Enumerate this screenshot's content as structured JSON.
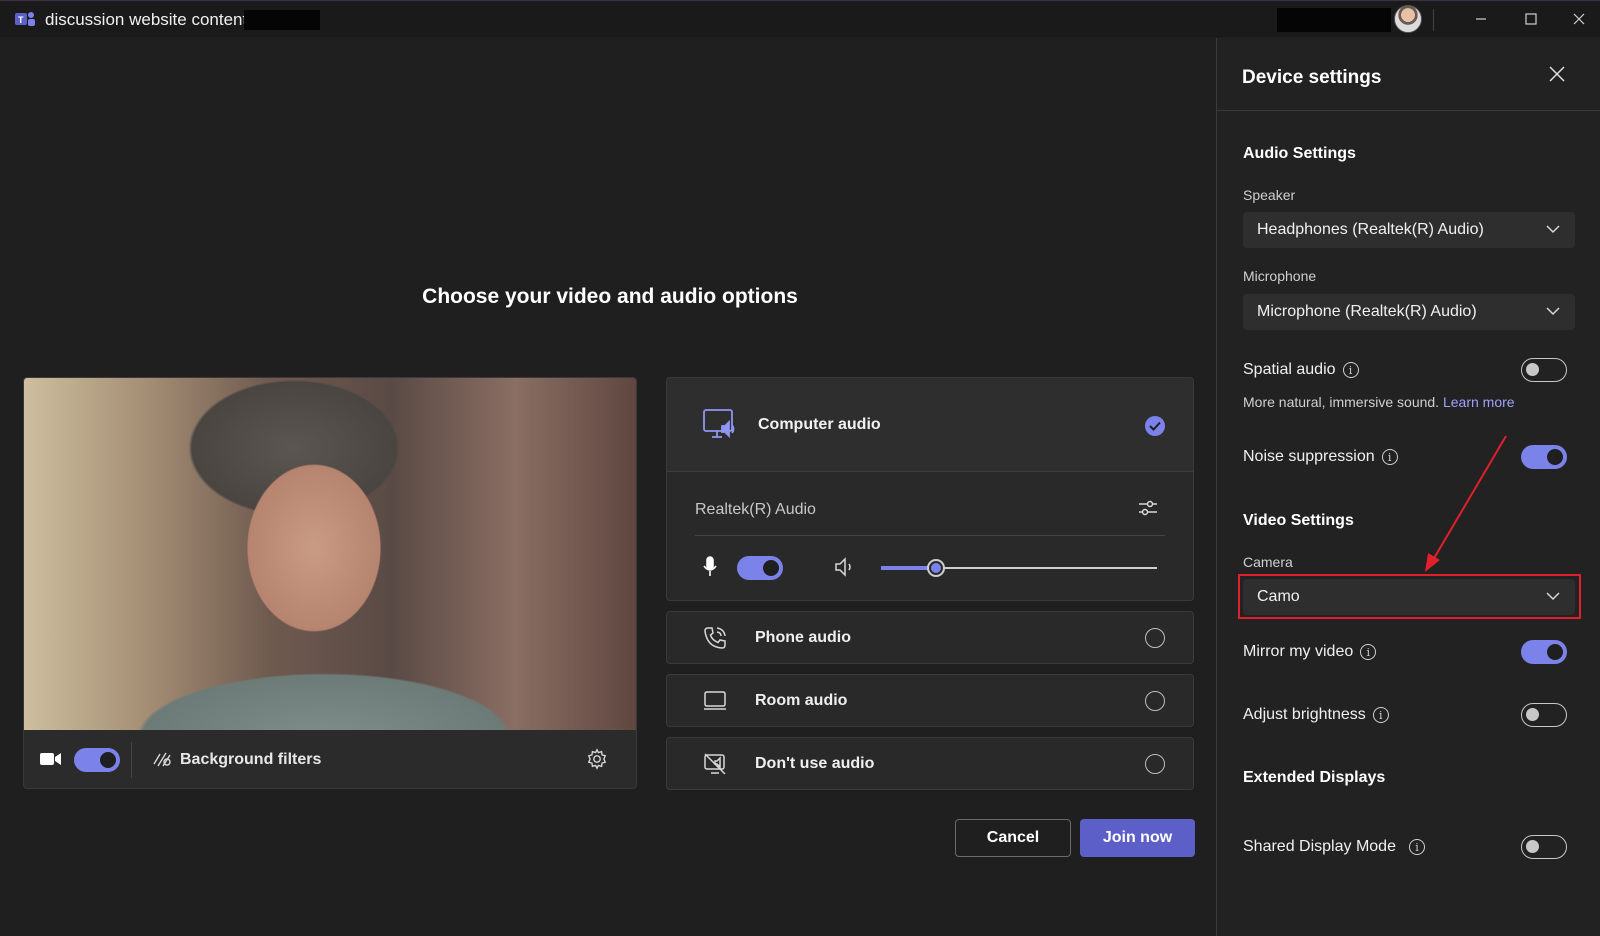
{
  "window": {
    "title": "discussion website content",
    "controls": [
      "minimize",
      "maximize",
      "close"
    ]
  },
  "main": {
    "heading": "Choose your video and audio options",
    "video": {
      "camera_on": true,
      "background_filters_label": "Background filters"
    },
    "audio": {
      "computer_audio": {
        "label": "Computer audio",
        "selected": true,
        "device": "Realtek(R) Audio",
        "mic_on": true,
        "volume": 0.2
      },
      "options": [
        {
          "label": "Phone audio",
          "icon": "phone-icon",
          "selected": false
        },
        {
          "label": "Room audio",
          "icon": "room-icon",
          "selected": false
        },
        {
          "label": "Don't use audio",
          "icon": "no-audio-icon",
          "selected": false
        }
      ]
    },
    "buttons": {
      "cancel": "Cancel",
      "join": "Join now"
    }
  },
  "panel": {
    "title": "Device settings",
    "audio_settings": {
      "heading": "Audio Settings",
      "speaker_label": "Speaker",
      "speaker_value": "Headphones (Realtek(R) Audio)",
      "microphone_label": "Microphone",
      "microphone_value": "Microphone (Realtek(R) Audio)",
      "spatial_audio_label": "Spatial audio",
      "spatial_audio_on": false,
      "spatial_desc": "More natural, immersive sound.",
      "learn_more": "Learn more",
      "noise_suppression_label": "Noise suppression",
      "noise_suppression_on": true
    },
    "video_settings": {
      "heading": "Video Settings",
      "camera_label": "Camera",
      "camera_value": "Camo",
      "mirror_label": "Mirror my video",
      "mirror_on": true,
      "brightness_label": "Adjust brightness",
      "brightness_on": false
    },
    "extended_displays": {
      "heading": "Extended Displays",
      "shared_display_label": "Shared Display Mode",
      "shared_display_on": false
    }
  },
  "colors": {
    "accent": "#7b83eb",
    "primary_button": "#5b5fc7",
    "annotation": "#e0202a"
  }
}
